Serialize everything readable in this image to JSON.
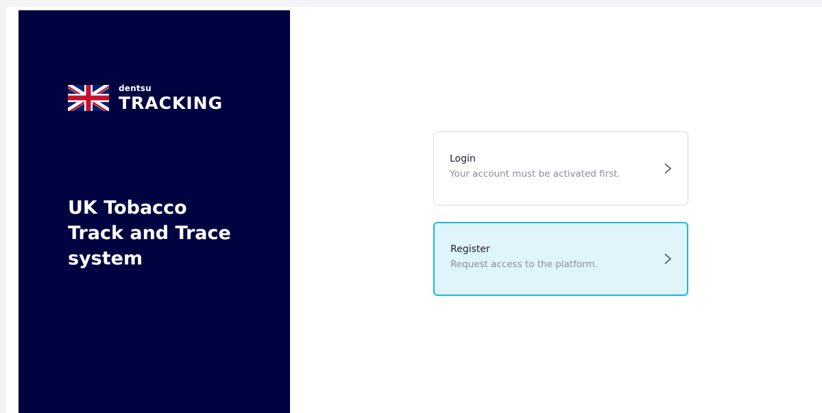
{
  "sidebar": {
    "logo": {
      "brand": "dentsu",
      "product": "TRACKING",
      "flag_icon": "union-jack-flag-icon"
    },
    "headline": "UK Tobacco\nTrack and Trace\nsystem",
    "background_color": "#000340"
  },
  "cards": {
    "login": {
      "title": "Login",
      "subtitle": "Your account must be activated first.",
      "icon": "chevron-right-icon"
    },
    "register": {
      "title": "Register",
      "subtitle": "Request access to the platform.",
      "icon": "chevron-right-icon",
      "highlight_border": "#19b6db",
      "highlight_background": "#dff5fb"
    }
  }
}
